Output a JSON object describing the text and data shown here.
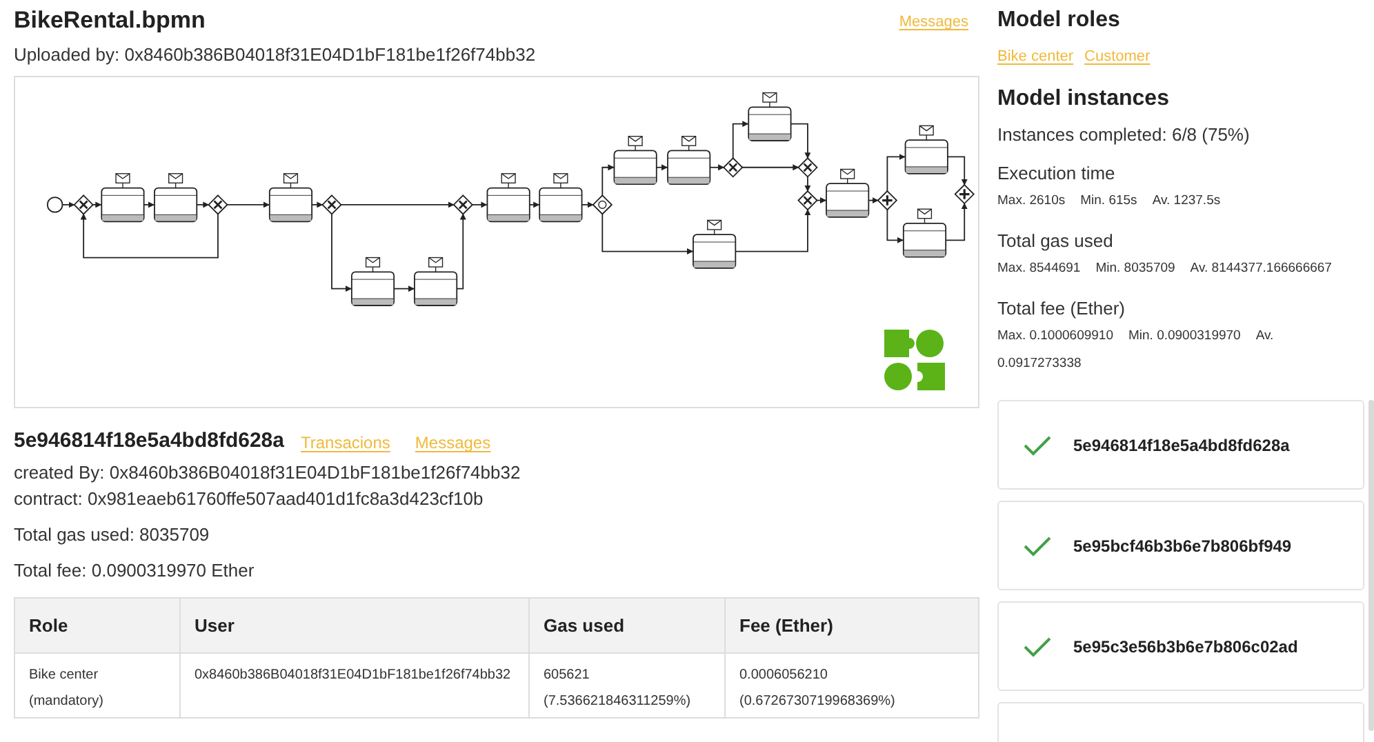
{
  "model": {
    "title": "BikeRental.bpmn",
    "messages_link": "Messages",
    "uploaded_by": "Uploaded by: 0x8460b386B04018f31E04D1bF181be1f26f74bb32"
  },
  "instance": {
    "id": "5e946814f18e5a4bd8fd628a",
    "links": [
      "Transacions",
      "Messages"
    ],
    "created_by": "created By: 0x8460b386B04018f31E04D1bF181be1f26f74bb32",
    "contract": "contract: 0x981eaeb61760ffe507aad401d1fc8a3d423cf10b",
    "total_gas": "Total gas used: 8035709",
    "total_fee": "Total fee: 0.0900319970 Ether"
  },
  "table": {
    "columns": [
      "Role",
      "User",
      "Gas used",
      "Fee (Ether)"
    ],
    "rows": [
      {
        "cells": [
          [
            "Bike center",
            "(mandatory)"
          ],
          [
            "0x8460b386B04018f31E04D1bF181be1f26f74bb32"
          ],
          [
            "605621",
            "(7.536621846311259%)"
          ],
          [
            "0.0006056210",
            "(0.6726730719968369%)"
          ]
        ]
      }
    ]
  },
  "model_roles": {
    "title": "Model roles",
    "roles": [
      "Bike center",
      "Customer"
    ]
  },
  "model_instances": {
    "title": "Model instances",
    "completed": "Instances completed: 6/8 (75%)",
    "stats": [
      {
        "label": "Execution time",
        "values": [
          "Max. 2610s",
          "Min. 615s",
          "Av. 1237.5s"
        ]
      },
      {
        "label": "Total gas used",
        "values": [
          "Max. 8544691",
          "Min. 8035709",
          "Av. 8144377.166666667"
        ]
      },
      {
        "label": "Total fee (Ether)",
        "values": [
          "Max. 0.1000609910",
          "Min. 0.0900319970",
          "Av. 0.0917273338"
        ]
      }
    ]
  },
  "instances": [
    {
      "kind": "instance",
      "id": "5e946814f18e5a4bd8fd628a",
      "completed": true
    },
    {
      "kind": "instance",
      "id": "5e95bcf46b3b6e7b806bf949",
      "completed": true
    },
    {
      "kind": "instance",
      "id": "5e95c3e56b3b6e7b806c02ad",
      "completed": true
    },
    {
      "kind": "cut_off"
    }
  ]
}
